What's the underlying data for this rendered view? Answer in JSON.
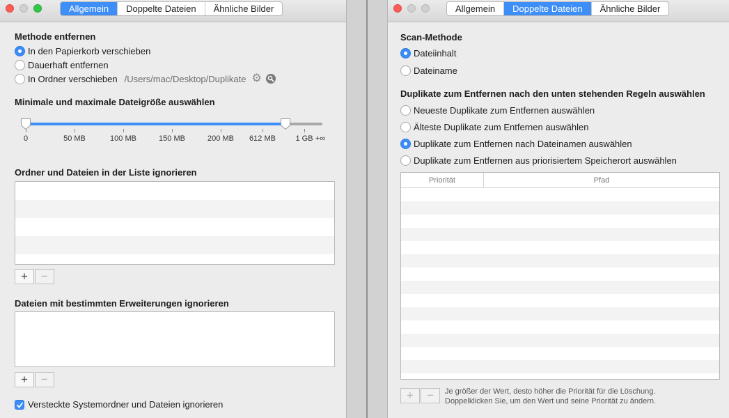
{
  "left": {
    "tabs": [
      {
        "label": "Allgemein",
        "active": true
      },
      {
        "label": "Doppelte Dateien",
        "active": false
      },
      {
        "label": "Ähnliche Bilder",
        "active": false
      }
    ],
    "remove_method": {
      "heading": "Methode entfernen",
      "options": [
        {
          "label": "In den Papierkorb verschieben",
          "selected": true
        },
        {
          "label": "Dauerhaft entfernen",
          "selected": false
        },
        {
          "label": "In Ordner verschieben",
          "selected": false
        }
      ],
      "folder_path": "/Users/mac/Desktop/Duplikate"
    },
    "size": {
      "heading": "Minimale und maximale Dateigröße auswählen",
      "ticks": [
        "0",
        "50 MB",
        "100 MB",
        "150 MB",
        "200 MB",
        "612 MB",
        "1 GB",
        "+∞"
      ],
      "min_index": 0,
      "max_index": 5
    },
    "ignore_folders": {
      "heading": "Ordner und Dateien in der Liste ignorieren"
    },
    "ignore_ext": {
      "heading": "Dateien mit bestimmten Erweiterungen ignorieren"
    },
    "buttons": {
      "add": "+",
      "remove": "−"
    },
    "hidden_checkbox": {
      "label": "Versteckte Systemordner und Dateien ignorieren",
      "checked": true
    }
  },
  "right": {
    "tabs": [
      {
        "label": "Allgemein",
        "active": false
      },
      {
        "label": "Doppelte Dateien",
        "active": true
      },
      {
        "label": "Ähnliche Bilder",
        "active": false
      }
    ],
    "scan_method": {
      "heading": "Scan-Methode",
      "options": [
        {
          "label": "Dateiinhalt",
          "selected": true
        },
        {
          "label": "Dateiname",
          "selected": false
        }
      ]
    },
    "rules": {
      "heading": "Duplikate zum Entfernen nach den unten stehenden Regeln auswählen",
      "options": [
        {
          "label": "Neueste Duplikate zum Entfernen auswählen",
          "selected": false
        },
        {
          "label": "Älteste Duplikate zum Entfernen auswählen",
          "selected": false
        },
        {
          "label": "Duplikate zum Entfernen nach Dateinamen auswählen",
          "selected": true
        },
        {
          "label": "Duplikate zum Entfernen aus priorisiertem Speicherort auswählen",
          "selected": false
        }
      ]
    },
    "table": {
      "col_priority": "Priorität",
      "col_path": "Pfad"
    },
    "buttons": {
      "add": "+",
      "remove": "−"
    },
    "hint_line1": "Je größer der Wert, desto höher die Priorität für die Löschung.",
    "hint_line2": "Doppelklicken Sie, um den Wert und seine Priorität zu ändern."
  },
  "colors": {
    "accent": "#3d8ef7",
    "slider_gray": "#a8a8a8"
  }
}
